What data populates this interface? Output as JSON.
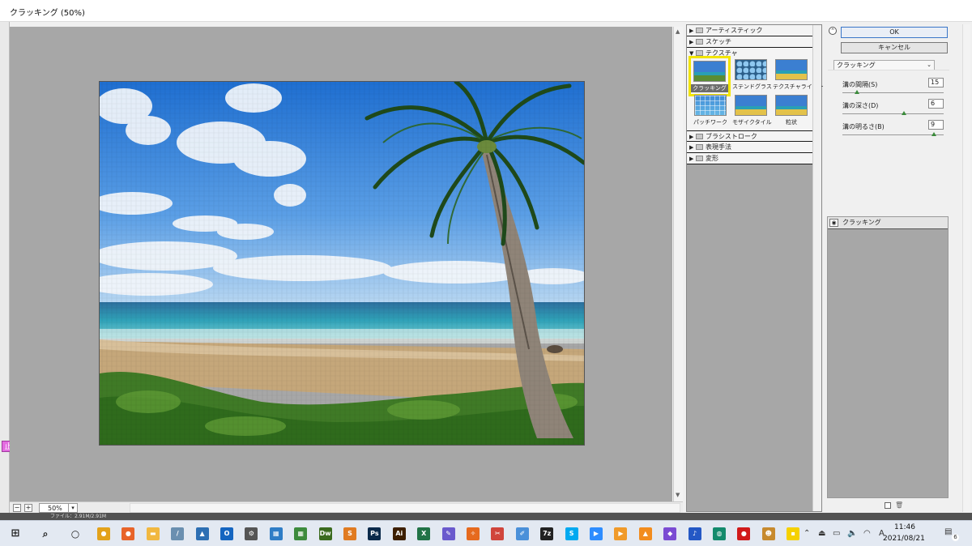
{
  "window": {
    "title": "クラッキング (50%)"
  },
  "left_badge": "止",
  "preview": {
    "zoom": "50%",
    "status_text": "ファイル：2.91M/2.91M"
  },
  "gallery": {
    "categories_top": [
      "アーティスティック",
      "スケッチ",
      "テクスチャ"
    ],
    "thumbnails": [
      {
        "label": "クラッキング",
        "selected": true
      },
      {
        "label": "ステンドグラス",
        "selected": false
      },
      {
        "label": "テクスチャライザー",
        "selected": false
      },
      {
        "label": "パッチワーク",
        "selected": false
      },
      {
        "label": "モザイクタイル",
        "selected": false
      },
      {
        "label": "粒状",
        "selected": false
      }
    ],
    "categories_bottom": [
      "ブラシストローク",
      "表現手法",
      "変形"
    ]
  },
  "right_panel": {
    "ok_label": "OK",
    "cancel_label": "キャンセル",
    "filter_select": "クラッキング",
    "params": [
      {
        "label": "溝の間隔(S)",
        "value": "15",
        "fraction": 0.12
      },
      {
        "label": "溝の深さ(D)",
        "value": "6",
        "fraction": 0.6
      },
      {
        "label": "溝の明るさ(B)",
        "value": "9",
        "fraction": 0.9
      }
    ],
    "layer_name": "クラッキング"
  },
  "taskbar": {
    "time": "11:46",
    "date": "2021/08/21",
    "ime": "A",
    "notifications": "6",
    "apps": [
      {
        "name": "chrome-icon",
        "color": "#e3a21a",
        "text": "●"
      },
      {
        "name": "firefox-icon",
        "color": "#e8642a",
        "text": "●"
      },
      {
        "name": "file-explorer-icon",
        "color": "#f1b840",
        "text": "▬"
      },
      {
        "name": "pen-icon",
        "color": "#6a8fb0",
        "text": "/"
      },
      {
        "name": "photos-icon",
        "color": "#2d6fb3",
        "text": "▲"
      },
      {
        "name": "outlook-icon",
        "color": "#1565c0",
        "text": "O"
      },
      {
        "name": "settings-icon",
        "color": "#555555",
        "text": "⚙"
      },
      {
        "name": "news-icon",
        "color": "#2f7dc6",
        "text": "▦"
      },
      {
        "name": "game-icon",
        "color": "#3d8b3d",
        "text": "▦"
      },
      {
        "name": "dreamweaver-icon",
        "color": "#3b6b1f",
        "text": "Dw"
      },
      {
        "name": "sublime-icon",
        "color": "#e07b22",
        "text": "S"
      },
      {
        "name": "photoshop-icon",
        "color": "#0b2a4a",
        "text": "Ps"
      },
      {
        "name": "illustrator-icon",
        "color": "#3d1f00",
        "text": "Ai"
      },
      {
        "name": "excel-icon",
        "color": "#217346",
        "text": "X"
      },
      {
        "name": "notepad-icon",
        "color": "#6a5acd",
        "text": "✎"
      },
      {
        "name": "butterfly-icon",
        "color": "#e66a1e",
        "text": "✧"
      },
      {
        "name": "snip-icon",
        "color": "#d0453c",
        "text": "✂"
      },
      {
        "name": "paint-icon",
        "color": "#4a90d9",
        "text": "✐"
      },
      {
        "name": "7zip-icon",
        "color": "#222222",
        "text": "7z"
      },
      {
        "name": "skype-icon",
        "color": "#00a9f0",
        "text": "S"
      },
      {
        "name": "zoom-icon",
        "color": "#2d8cff",
        "text": "▶"
      },
      {
        "name": "media-icon",
        "color": "#f09a2a",
        "text": "▶"
      },
      {
        "name": "vlc-icon",
        "color": "#f28c1e",
        "text": "▲"
      },
      {
        "name": "purple-app-icon",
        "color": "#7a4bd3",
        "text": "◆"
      },
      {
        "name": "music-icon",
        "color": "#2458c5",
        "text": "♪"
      },
      {
        "name": "globe-icon",
        "color": "#138a6c",
        "text": "◍"
      },
      {
        "name": "record-icon",
        "color": "#d11a1a",
        "text": "●"
      },
      {
        "name": "frog-icon",
        "color": "#c78a2e",
        "text": "☻"
      },
      {
        "name": "sticky-notes-icon",
        "color": "#f5d100",
        "text": "▪"
      }
    ]
  }
}
